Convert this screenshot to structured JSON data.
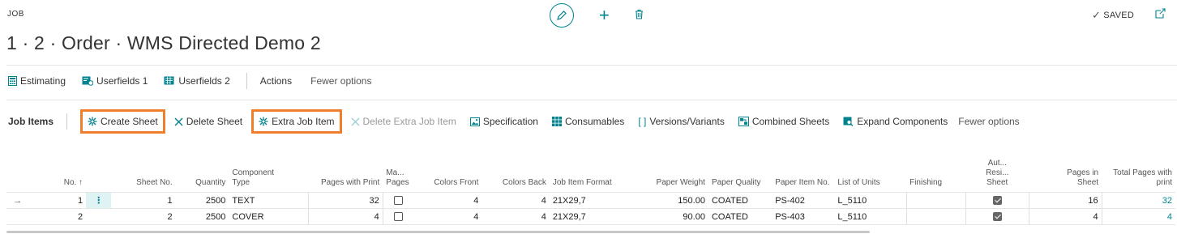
{
  "header": {
    "context_label": "JOB",
    "title": "1 · 2 · Order · WMS Directed Demo 2",
    "saved_label": "SAVED",
    "icons": [
      "edit-icon",
      "plus-icon",
      "trash-icon",
      "check-icon",
      "open-new-window-icon"
    ]
  },
  "actionbar1": {
    "estimating": "Estimating",
    "userfields1": "Userfields 1",
    "userfields2": "Userfields 2",
    "actions": "Actions",
    "fewer": "Fewer options"
  },
  "actionbar2": {
    "title": "Job Items",
    "create_sheet": "Create Sheet",
    "delete_sheet": "Delete Sheet",
    "extra_job_item": "Extra Job Item",
    "delete_extra_job_item": "Delete Extra Job Item",
    "specification": "Specification",
    "consumables": "Consumables",
    "versions_variants": "Versions/Variants",
    "combined_sheets": "Combined Sheets",
    "expand_components": "Expand Components",
    "fewer": "Fewer options"
  },
  "table": {
    "headers": {
      "no": "No. ↑",
      "sheet_no": "Sheet No.",
      "quantity": "Quantity",
      "component_type_1": "Component",
      "component_type_2": "Type",
      "pages_with_print": "Pages with Print",
      "ma_pages_1": "Ma...",
      "ma_pages_2": "Pages",
      "colors_front": "Colors Front",
      "colors_back": "Colors Back",
      "job_item_format": "Job Item Format",
      "paper_weight": "Paper Weight",
      "paper_quality": "Paper Quality",
      "paper_item_no": "Paper Item No.",
      "list_of_units": "List of Units",
      "finishing": "Finishing",
      "aut_1": "Aut...",
      "aut_2": "Resi...",
      "aut_3": "Sheet",
      "pages_in_sheet_1": "Pages in",
      "pages_in_sheet_2": "Sheet",
      "total_pages_1": "Total Pages with",
      "total_pages_2": "print"
    },
    "rows": [
      {
        "no": "1",
        "sheet_no": "1",
        "quantity": "2500",
        "component_type": "TEXT",
        "pages_with_print": "32",
        "colors_front": "4",
        "colors_back": "4",
        "job_item_format": "21X29,7",
        "paper_weight": "150.00",
        "paper_quality": "COATED",
        "paper_item_no": "PS-402",
        "list_of_units": "L_5110",
        "finishing": "",
        "pages_in_sheet": "16",
        "total_pages": "32"
      },
      {
        "no": "2",
        "sheet_no": "2",
        "quantity": "2500",
        "component_type": "COVER",
        "pages_with_print": "4",
        "colors_front": "4",
        "colors_back": "4",
        "job_item_format": "21X29,7",
        "paper_weight": "90.00",
        "paper_quality": "COATED",
        "paper_item_no": "PS-403",
        "list_of_units": "L_5110",
        "finishing": "",
        "pages_in_sheet": "4",
        "total_pages": "4"
      }
    ]
  },
  "colors": {
    "accent": "#00838f",
    "highlight_border": "#f07f2d"
  }
}
